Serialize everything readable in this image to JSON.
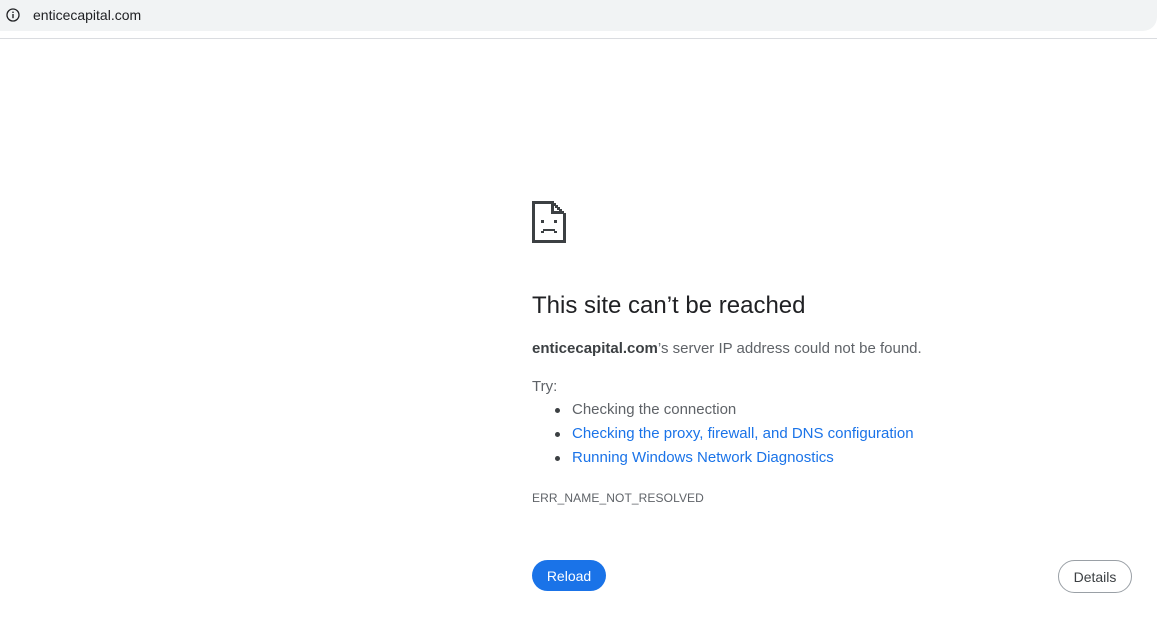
{
  "browser": {
    "url": "enticecapital.com",
    "icon": "info-icon"
  },
  "error": {
    "icon": "sad-page-icon",
    "title": "This site can’t be reached",
    "domain": "enticecapital.com",
    "message": "’s server IP address could not be found.",
    "try_label": "Try:",
    "suggestions": [
      {
        "label": "Checking the connection",
        "is_link": false
      },
      {
        "label": "Checking the proxy, firewall, and DNS configuration",
        "is_link": true
      },
      {
        "label": "Running Windows Network Diagnostics",
        "is_link": true
      }
    ],
    "code": "ERR_NAME_NOT_RESOLVED"
  },
  "actions": {
    "reload_label": "Reload",
    "details_label": "Details"
  },
  "colors": {
    "accent": "#1a73e8",
    "text_primary": "#202124",
    "text_secondary": "#5f6368",
    "toolbar_bg": "#f1f3f4"
  }
}
